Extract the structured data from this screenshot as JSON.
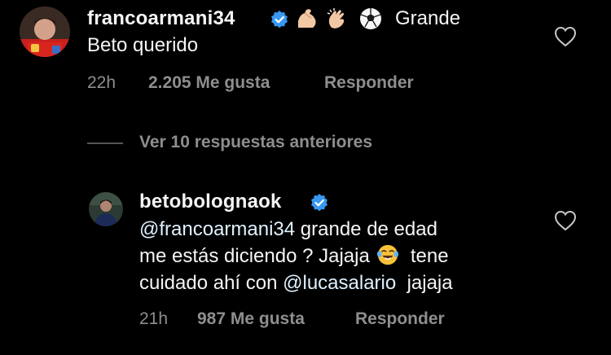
{
  "comment1": {
    "username": "francoarmani34",
    "emoji_sequence": [
      "flexed-biceps",
      "clapping-hands",
      "soccer-ball"
    ],
    "text_line1": "Grande",
    "text_line2": "Beto querido",
    "time": "22h",
    "likes": "2.205 Me gusta",
    "reply_label": "Responder"
  },
  "view_replies": "Ver 10 respuestas anteriores",
  "reply": {
    "username": "betobolognaok",
    "mention1": "@francoarmani34",
    "line1_rest": " grande de edad",
    "line2_start": "me estás diciendo ? Jajaja ",
    "line2_end": "  tene",
    "line3_start": "cuidado ahí con ",
    "mention2": "@lucasalario",
    "line3_end": "  jajaja",
    "time": "21h",
    "likes": "987 Me gusta",
    "reply_label": "Responder"
  },
  "colors": {
    "background": "#000000",
    "text": "#f5f5f5",
    "meta": "#8e8e8e",
    "verified": "#3897f0",
    "mention": "#e0f1ff"
  }
}
